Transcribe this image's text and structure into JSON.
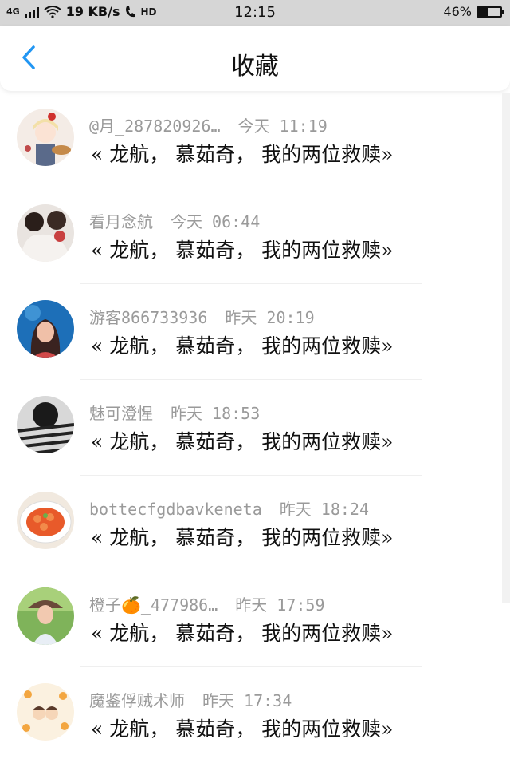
{
  "status_bar": {
    "network": "4G",
    "speed": "19 KB/s",
    "hd": "HD",
    "time": "12:15",
    "battery_percent": "46%",
    "battery_level": 0.46
  },
  "header": {
    "title": "收藏",
    "back_icon": "chevron-left-icon",
    "accent_color": "#2196f3"
  },
  "items": [
    {
      "user": "@月_287820926…",
      "time": "今天 11:19",
      "content": "« 龙航， 慕茹奇， 我的两位救赎»",
      "avatar": "anime-girl-avatar"
    },
    {
      "user": "看月念航",
      "time": "今天 06:44",
      "content": "« 龙航， 慕茹奇， 我的两位救赎»",
      "avatar": "two-people-avatar"
    },
    {
      "user": "游客866733936",
      "time": "昨天 20:19",
      "content": "« 龙航， 慕茹奇， 我的两位救赎»",
      "avatar": "girl-blue-avatar"
    },
    {
      "user": "魅可澄惺",
      "time": "昨天 18:53",
      "content": "« 龙航， 慕茹奇， 我的两位救赎»",
      "avatar": "striped-shirt-avatar"
    },
    {
      "user": "bottecfgdbavkeneta",
      "time": "昨天 18:24",
      "content": "« 龙航， 慕茹奇， 我的两位救赎»",
      "avatar": "food-dish-avatar"
    },
    {
      "user": "橙子🍊_477986…",
      "time": "昨天 17:59",
      "content": "« 龙航， 慕茹奇， 我的两位救赎»",
      "avatar": "girl-outdoor-avatar"
    },
    {
      "user": "魔鉴俘贼术师",
      "time": "昨天 17:34",
      "content": "« 龙航， 慕茹奇， 我的两位救赎»",
      "avatar": "cartoon-avatar"
    }
  ]
}
